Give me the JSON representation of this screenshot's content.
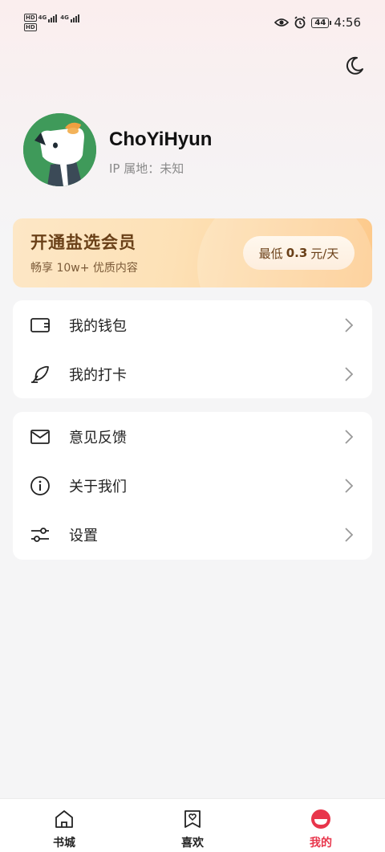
{
  "status_bar": {
    "sim1": "HD",
    "sim2": "HD",
    "net1": "4G",
    "net2": "4G",
    "battery": "44",
    "time": "4:56"
  },
  "profile": {
    "username": "ChoYiHyun",
    "ip_location": "IP 属地：未知"
  },
  "vip": {
    "title": "开通盐选会员",
    "subtitle": "畅享 10w+ 优质内容",
    "price_prefix": "最低",
    "price_value": "0.3",
    "price_suffix": "元/天"
  },
  "menu_group1": [
    {
      "label": "我的钱包",
      "icon": "wallet-icon"
    },
    {
      "label": "我的打卡",
      "icon": "feather-icon"
    }
  ],
  "menu_group2": [
    {
      "label": "意见反馈",
      "icon": "mail-icon"
    },
    {
      "label": "关于我们",
      "icon": "info-icon"
    },
    {
      "label": "设置",
      "icon": "sliders-icon"
    }
  ],
  "tabs": [
    {
      "label": "书城",
      "icon": "home-icon"
    },
    {
      "label": "喜欢",
      "icon": "heart-bookmark-icon"
    },
    {
      "label": "我的",
      "icon": "profile-icon",
      "active": true
    }
  ],
  "colors": {
    "accent": "#e8354b",
    "vip_text": "#6a4018",
    "vip_gradient_start": "#fde7c6",
    "vip_gradient_end": "#fdc98a",
    "avatar_bg": "#3f9a5a"
  }
}
